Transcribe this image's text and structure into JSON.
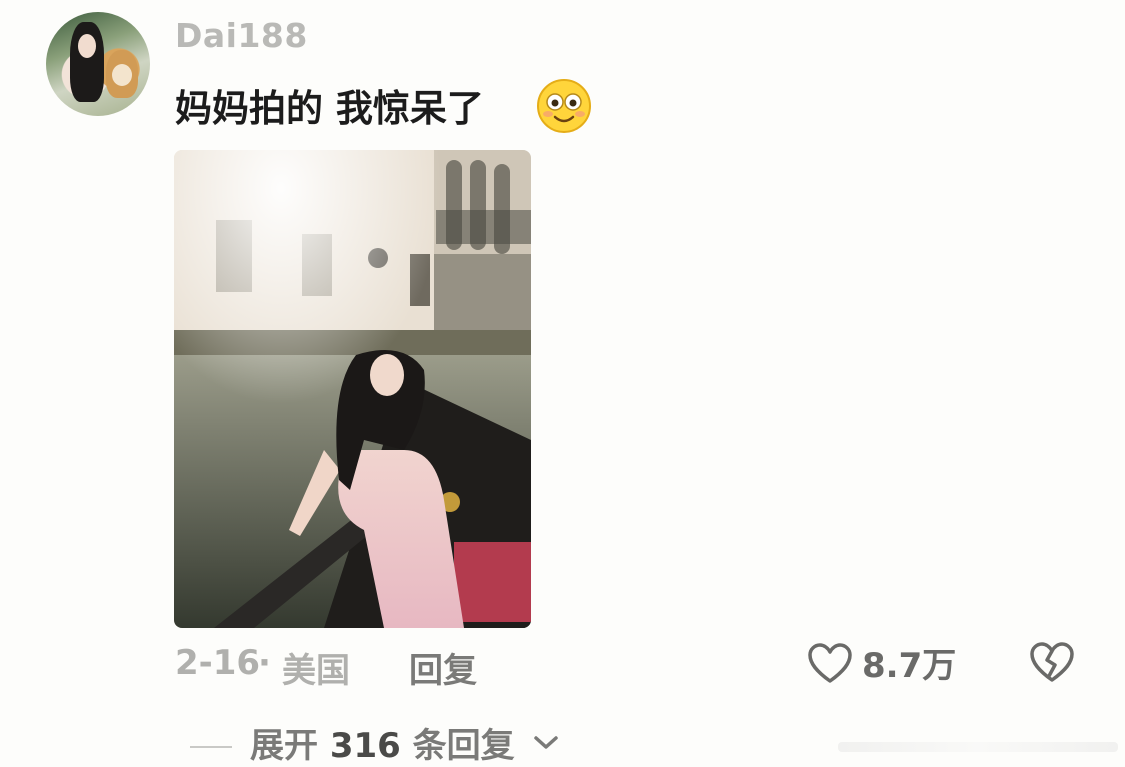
{
  "comment": {
    "username": "Dai188",
    "text": "妈妈拍的 我惊呆了",
    "emoji": "smiling-face-emoji",
    "date": "2-16",
    "separator": "·",
    "location": "美国",
    "reply_label": "回复",
    "likes": "8.7万"
  },
  "replies": {
    "expand_prefix": "展开",
    "count": "316",
    "expand_suffix": "条回复"
  },
  "colors": {
    "background": "#fdfdfb",
    "username": "#b9b9b6",
    "comment_text": "#1c1c1c",
    "meta": "#b0b0ad"
  }
}
